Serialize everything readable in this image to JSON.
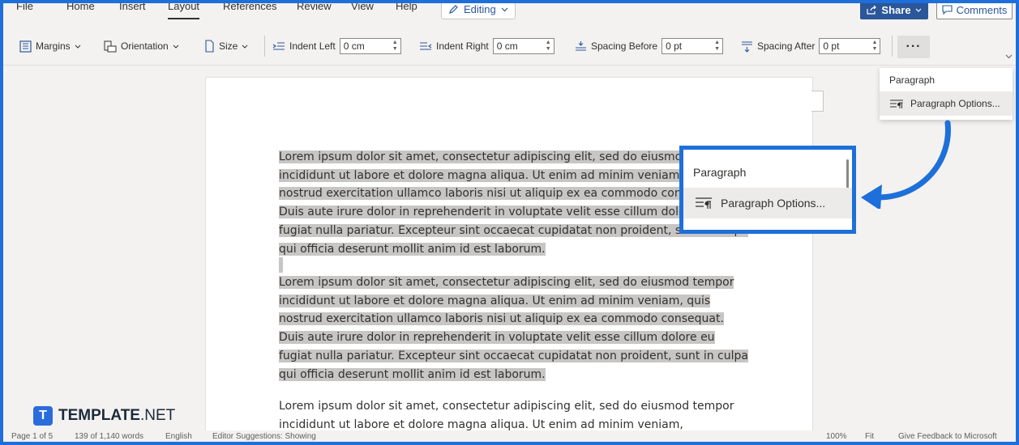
{
  "menu": {
    "items": [
      "File",
      "Home",
      "Insert",
      "Layout",
      "References",
      "Review",
      "View",
      "Help"
    ],
    "active": "Layout",
    "editing_label": "Editing",
    "share_label": "Share",
    "comments_label": "Comments"
  },
  "ribbon": {
    "margins_label": "Margins",
    "orientation_label": "Orientation",
    "size_label": "Size",
    "indent_left_label": "Indent Left",
    "indent_left_value": "0 cm",
    "indent_right_label": "Indent Right",
    "indent_right_value": "0 cm",
    "spacing_before_label": "Spacing Before",
    "spacing_before_value": "0 pt",
    "spacing_after_label": "Spacing After",
    "spacing_after_value": "0 pt",
    "more_label": "···"
  },
  "popup": {
    "header": "Paragraph",
    "option": "Paragraph Options..."
  },
  "callout": {
    "header": "Paragraph",
    "option": "Paragraph Options..."
  },
  "document": {
    "paragraphs": [
      "Lorem ipsum dolor sit amet, consectetur adipiscing elit, sed do eiusmod tempor incididunt ut labore et dolore magna aliqua. Ut enim ad minim veniam, quis nostrud exercitation ullamco laboris nisi ut aliquip ex ea commodo consequat. Duis aute irure dolor in reprehenderit in voluptate velit esse cillum dolore eu fugiat nulla pariatur. Excepteur sint occaecat cupidatat non proident, sunt in culpa qui officia deserunt mollit anim id est laborum.",
      "Lorem ipsum dolor sit amet, consectetur adipiscing elit, sed do eiusmod tempor incididunt ut labore et dolore magna aliqua. Ut enim ad minim veniam, quis nostrud exercitation ullamco laboris nisi ut aliquip ex ea commodo consequat. Duis aute irure dolor in reprehenderit in voluptate velit esse cillum dolore eu fugiat nulla pariatur. Excepteur sint occaecat cupidatat non proident, sunt in culpa qui officia deserunt mollit anim id est laborum.",
      "Lorem ipsum dolor sit amet, consectetur adipiscing elit, sed do eiusmod tempor incididunt ut labore et dolore magna aliqua. Ut enim ad minim veniam,"
    ]
  },
  "statusbar": {
    "page": "Page 1 of 5",
    "words": "139 of 1,140 words",
    "language": "English",
    "suggestions": "Editor Suggestions: Showing",
    "zoom": "100%",
    "fit": "Fit",
    "feedback": "Give Feedback to Microsoft"
  },
  "logo": {
    "letter": "T",
    "brand_bold": "TEMPLATE",
    "brand_suffix": ".NET"
  },
  "colors": {
    "accent": "#1e6fd9",
    "share": "#2b579a",
    "highlight": "#c8c6c4"
  }
}
